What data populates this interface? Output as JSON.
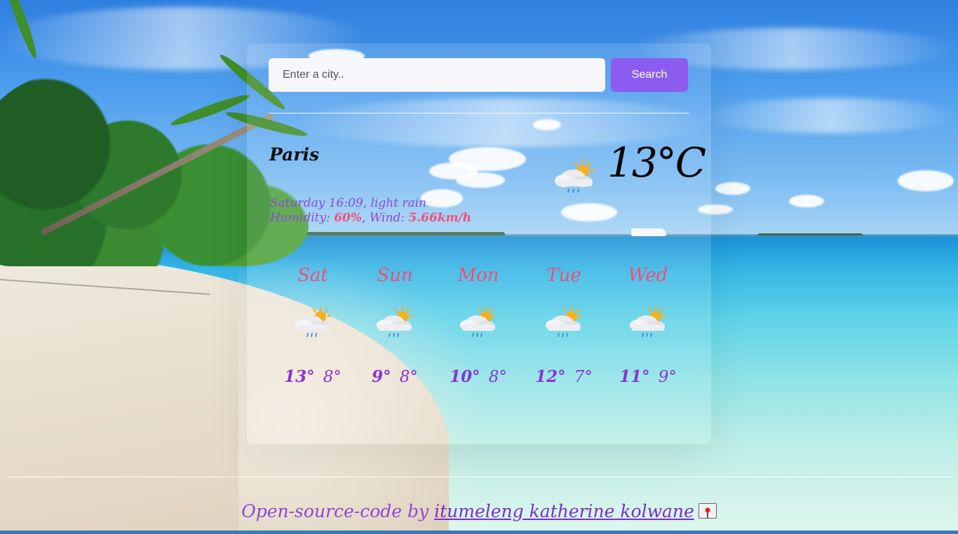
{
  "search": {
    "placeholder": "Enter a city..",
    "button_label": "Search"
  },
  "current": {
    "city": "Paris",
    "day_time_prefix": "Saturday 16:09, light rain",
    "humidity_label": "Humidity: ",
    "humidity_value": "60%",
    "wind_label": ", Wind: ",
    "wind_value": "5.66km/h",
    "temperature": "13°C",
    "icon": "sun-cloud-rain-icon"
  },
  "forecast": [
    {
      "day": "Sat",
      "max": "13°",
      "min": "8°",
      "icon": "sun-cloud-rain-icon"
    },
    {
      "day": "Sun",
      "max": "9°",
      "min": "8°",
      "icon": "sun-cloud-rain-icon"
    },
    {
      "day": "Mon",
      "max": "10°",
      "min": "8°",
      "icon": "sun-cloud-rain-icon"
    },
    {
      "day": "Tue",
      "max": "12°",
      "min": "7°",
      "icon": "sun-cloud-rain-icon"
    },
    {
      "day": "Wed",
      "max": "11°",
      "min": "9°",
      "icon": "sun-cloud-rain-icon"
    }
  ],
  "footer": {
    "prefix": "Open-source-code by ",
    "link_text": "itumeleng katherine kolwane",
    "pin_icon": "pin-icon"
  },
  "colors": {
    "accent": "#8c5cf0",
    "day_name": "#ef4e79",
    "temp": "#8a35cf",
    "highlight": "#f0507c"
  }
}
